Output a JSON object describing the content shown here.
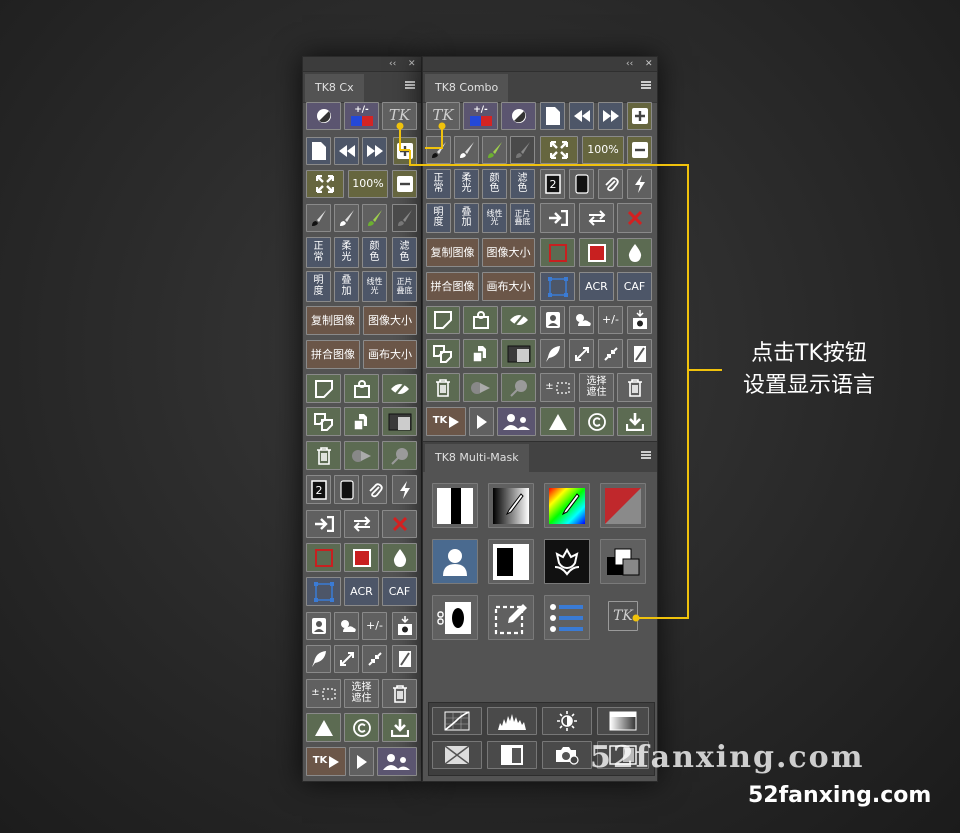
{
  "panel_cx": {
    "tab": "TK8 Cx"
  },
  "panel_combo": {
    "tab": "TK8 Combo"
  },
  "panel_mask": {
    "tab": "TK8 Multi-Mask"
  },
  "labels": {
    "zoom": "100%",
    "plusminus": "+/-",
    "tk": "TK",
    "acr": "ACR",
    "caf": "CAF",
    "pm_sel": "±",
    "blend_normal_1": "正",
    "blend_normal_2": "常",
    "blend_soft_1": "柔",
    "blend_soft_2": "光",
    "blend_color_1": "颜",
    "blend_color_2": "色",
    "blend_screen_1": "滤",
    "blend_screen_2": "色",
    "blend_lum_1": "明",
    "blend_lum_2": "度",
    "blend_overlay_1": "叠",
    "blend_overlay_2": "加",
    "blend_linlight_1": "线性",
    "blend_linlight_2": "光",
    "blend_multiply_1": "正片",
    "blend_multiply_2": "叠底",
    "dup_image": "复制图像",
    "image_size": "图像大小",
    "flatten": "拼合图像",
    "canvas_size": "画布大小",
    "select_mask_1": "选择",
    "select_mask_2": "遮住"
  },
  "callout": {
    "line1": "点击TK按钮",
    "line2": "设置显示语言"
  },
  "watermark": {
    "big": "52fanxing.com",
    "small": "52fanxing.com"
  },
  "colors": {
    "accent_yellow": "#f0c20c"
  }
}
